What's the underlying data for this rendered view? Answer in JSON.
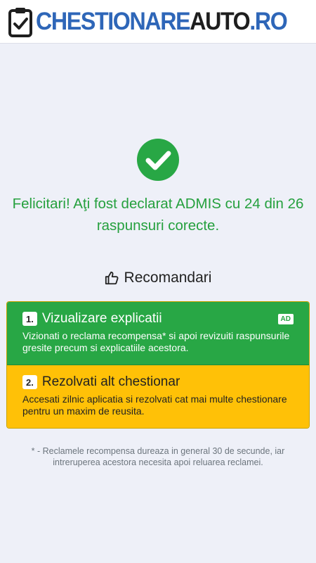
{
  "header": {
    "logo_part1": "CHESTIONARE",
    "logo_part2": "AUTO",
    "logo_part3": ".RO",
    "logo_icon": "clipboard-check-icon"
  },
  "result": {
    "icon": "check-circle-icon",
    "message": "Felicitari! Aţi fost declarat ADMIS cu 24 din 26 raspunsuri corecte."
  },
  "recommendations": {
    "icon": "thumbs-up-icon",
    "title": "Recomandari",
    "items": [
      {
        "number": "1.",
        "title": "Vizualizare explicatii",
        "badge": "AD",
        "description": "Vizionati o reclama recompensa* si apoi revizuiti raspunsurile gresite precum si explicatiile acestora."
      },
      {
        "number": "2.",
        "title": "Rezolvati alt chestionar",
        "description": "Accesati zilnic aplicatia si rezolvati cat mai multe chestionare pentru un maxim de reusita."
      }
    ]
  },
  "footnote": "* - Reclamele recompensa dureaza in general 30 de secunde, iar intreruperea acestora necesita apoi reluarea reclamei.",
  "colors": {
    "success": "#28a745",
    "warning": "#ffc107",
    "brand_blue": "#2e66b8",
    "background": "#eef0f8"
  }
}
